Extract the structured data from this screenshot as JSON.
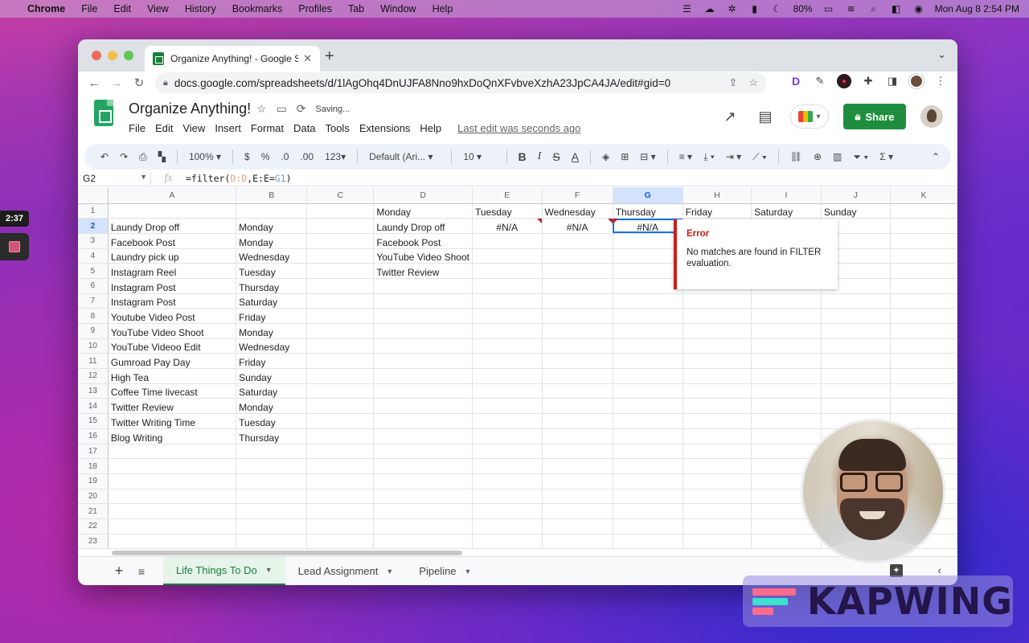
{
  "menubar": {
    "app": "Chrome",
    "items": [
      "File",
      "Edit",
      "View",
      "History",
      "Bookmarks",
      "Profiles",
      "Tab",
      "Window",
      "Help"
    ],
    "battery": "80%",
    "clock": "Mon Aug 8  2:54 PM"
  },
  "recorder": {
    "timer": "2:37"
  },
  "browser": {
    "tab_title": "Organize Anything! - Google Sh",
    "url": "docs.google.com/spreadsheets/d/1lAgOhq4DnUJFA8Nno9hxDoQnXFvbveXzhA23JpCA4JA/edit#gid=0",
    "ext_d": "D"
  },
  "sheets": {
    "title": "Organize Anything!",
    "saving": "Saving...",
    "menu": [
      "File",
      "Edit",
      "View",
      "Insert",
      "Format",
      "Data",
      "Tools",
      "Extensions",
      "Help"
    ],
    "last_edit": "Last edit was seconds ago",
    "share": "Share"
  },
  "format_toolbar": {
    "zoom": "100%",
    "currency": "$",
    "percent": "%",
    "dec_less": ".0",
    "dec_more": ".00",
    "number_fmt": "123",
    "font": "Default (Ari...",
    "size": "10",
    "bold": "B",
    "italic": "I",
    "strike": "S",
    "text_color": "A"
  },
  "formula_bar": {
    "name_box": "G2",
    "fx": "fx",
    "formula_prefix": "=filter(",
    "formula_ref1": "D:D",
    "formula_mid": ",E:E=",
    "formula_ref2": "G1",
    "formula_suffix": ")"
  },
  "grid": {
    "columns": [
      "A",
      "B",
      "C",
      "D",
      "E",
      "F",
      "G",
      "H",
      "I",
      "J",
      "K"
    ],
    "active_column": "G",
    "active_row": "2",
    "rows": [
      {
        "n": "1",
        "A": "",
        "B": "",
        "C": "",
        "D": "Monday",
        "E": "Tuesday",
        "F": "Wednesday",
        "G": "Thursday",
        "H": "Friday",
        "I": "Saturday",
        "J": "Sunday",
        "K": ""
      },
      {
        "n": "2",
        "A": "Laundy Drop off",
        "B": "Monday",
        "C": "",
        "D": "Laundy Drop off",
        "E": "#N/A",
        "F": "#N/A",
        "G": "#N/A",
        "H": "",
        "I": "",
        "J": "",
        "K": ""
      },
      {
        "n": "3",
        "A": "Facebook Post",
        "B": "Monday",
        "C": "",
        "D": "Facebook Post",
        "E": "",
        "F": "",
        "G": "",
        "H": "",
        "I": "",
        "J": "",
        "K": ""
      },
      {
        "n": "4",
        "A": "Laundry pick up",
        "B": "Wednesday",
        "C": "",
        "D": "YouTube Video Shoot",
        "E": "",
        "F": "",
        "G": "",
        "H": "",
        "I": "",
        "J": "",
        "K": ""
      },
      {
        "n": "5",
        "A": "Instagram Reel",
        "B": "Tuesday",
        "C": "",
        "D": "Twitter Review",
        "E": "",
        "F": "",
        "G": "",
        "H": "",
        "I": "",
        "J": "",
        "K": ""
      },
      {
        "n": "6",
        "A": "Instagram Post",
        "B": "Thursday",
        "C": "",
        "D": "",
        "E": "",
        "F": "",
        "G": "",
        "H": "",
        "I": "",
        "J": "",
        "K": ""
      },
      {
        "n": "7",
        "A": "Instagram Post",
        "B": "Saturday",
        "C": "",
        "D": "",
        "E": "",
        "F": "",
        "G": "",
        "H": "",
        "I": "",
        "J": "",
        "K": ""
      },
      {
        "n": "8",
        "A": "Youtube Video Post",
        "B": "Friday",
        "C": "",
        "D": "",
        "E": "",
        "F": "",
        "G": "",
        "H": "",
        "I": "",
        "J": "",
        "K": ""
      },
      {
        "n": "9",
        "A": "YouTube Video Shoot",
        "B": "Monday",
        "C": "",
        "D": "",
        "E": "",
        "F": "",
        "G": "",
        "H": "",
        "I": "",
        "J": "",
        "K": ""
      },
      {
        "n": "10",
        "A": "YouTube Videoo Edit",
        "B": "Wednesday",
        "C": "",
        "D": "",
        "E": "",
        "F": "",
        "G": "",
        "H": "",
        "I": "",
        "J": "",
        "K": ""
      },
      {
        "n": "11",
        "A": "Gumroad Pay Day",
        "B": "Friday",
        "C": "",
        "D": "",
        "E": "",
        "F": "",
        "G": "",
        "H": "",
        "I": "",
        "J": "",
        "K": ""
      },
      {
        "n": "12",
        "A": "High Tea",
        "B": "Sunday",
        "C": "",
        "D": "",
        "E": "",
        "F": "",
        "G": "",
        "H": "",
        "I": "",
        "J": "",
        "K": ""
      },
      {
        "n": "13",
        "A": "Coffee Time livecast",
        "B": "Saturday",
        "C": "",
        "D": "",
        "E": "",
        "F": "",
        "G": "",
        "H": "",
        "I": "",
        "J": "",
        "K": ""
      },
      {
        "n": "14",
        "A": "Twitter Review",
        "B": "Monday",
        "C": "",
        "D": "",
        "E": "",
        "F": "",
        "G": "",
        "H": "",
        "I": "",
        "J": "",
        "K": ""
      },
      {
        "n": "15",
        "A": "Twitter Writing Time",
        "B": "Tuesday",
        "C": "",
        "D": "",
        "E": "",
        "F": "",
        "G": "",
        "H": "",
        "I": "",
        "J": "",
        "K": ""
      },
      {
        "n": "16",
        "A": "Blog Writing",
        "B": "Thursday",
        "C": "",
        "D": "",
        "E": "",
        "F": "",
        "G": "",
        "H": "",
        "I": "",
        "J": "",
        "K": ""
      },
      {
        "n": "17",
        "A": "",
        "B": "",
        "C": "",
        "D": "",
        "E": "",
        "F": "",
        "G": "",
        "H": "",
        "I": "",
        "J": "",
        "K": ""
      },
      {
        "n": "18",
        "A": "",
        "B": "",
        "C": "",
        "D": "",
        "E": "",
        "F": "",
        "G": "",
        "H": "",
        "I": "",
        "J": "",
        "K": ""
      },
      {
        "n": "19",
        "A": "",
        "B": "",
        "C": "",
        "D": "",
        "E": "",
        "F": "",
        "G": "",
        "H": "",
        "I": "",
        "J": "",
        "K": ""
      },
      {
        "n": "20",
        "A": "",
        "B": "",
        "C": "",
        "D": "",
        "E": "",
        "F": "",
        "G": "",
        "H": "",
        "I": "",
        "J": "",
        "K": ""
      },
      {
        "n": "21",
        "A": "",
        "B": "",
        "C": "",
        "D": "",
        "E": "",
        "F": "",
        "G": "",
        "H": "",
        "I": "",
        "J": "",
        "K": ""
      },
      {
        "n": "22",
        "A": "",
        "B": "",
        "C": "",
        "D": "",
        "E": "",
        "F": "",
        "G": "",
        "H": "",
        "I": "",
        "J": "",
        "K": ""
      },
      {
        "n": "23",
        "A": "",
        "B": "",
        "C": "",
        "D": "",
        "E": "",
        "F": "",
        "G": "",
        "H": "",
        "I": "",
        "J": "",
        "K": ""
      }
    ],
    "error_cells": [
      "E2",
      "F2",
      "G2"
    ]
  },
  "error_tooltip": {
    "title": "Error",
    "message": "No matches are found in FILTER evaluation."
  },
  "sheet_tabs": [
    {
      "label": "Life Things To Do",
      "active": true
    },
    {
      "label": "Lead Assignment",
      "active": false
    },
    {
      "label": "Pipeline",
      "active": false
    }
  ],
  "watermark": {
    "text": "KAPWING"
  },
  "colors": {
    "sheets_green": "#188038",
    "error_red": "#c5221f",
    "selection_blue": "#1a73e8",
    "share_green": "#1e8e3e"
  }
}
